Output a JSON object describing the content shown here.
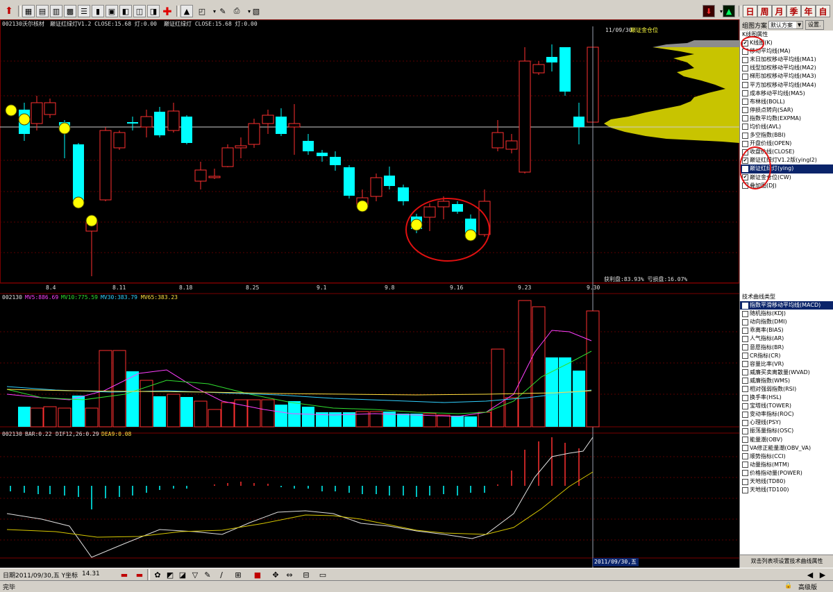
{
  "toolbar": {
    "periods": [
      "日",
      "周",
      "月",
      "季",
      "年",
      "自"
    ]
  },
  "main_chart": {
    "title_left": "002130沃尔核材",
    "indicator_text": "巅证红绿灯V1.2 CLOSE:15.68 灯:0.00",
    "indicator_text2": "巅证红绿灯 CLOSE:15.68 灯:0.00",
    "cursor_date_label": "11/09/30",
    "position_label": "巅证金仓位",
    "profit_text": "获利盘:83.93% 亏损盘:16.07%",
    "date_ticks": [
      "8.4",
      "8.11",
      "8.18",
      "8.25",
      "9.1",
      "9.8",
      "9.16",
      "9.23",
      "9.30"
    ]
  },
  "volume_panel": {
    "code": "002130",
    "mv5": "MV5:886.69",
    "mv10": "MV10:775.59",
    "mv30": "MV30:383.79",
    "mv65": "MV65:383.23"
  },
  "macd_panel": {
    "code": "002130",
    "bar": "BAR:0.22",
    "dif": "DIF12,26:0.29",
    "dea": "DEA9:0.08"
  },
  "right_panel": {
    "scheme_label": "组图方案",
    "scheme_value": "默认方案",
    "settings_button": "设置.",
    "kline_group": "K线图属性",
    "kline_items": [
      {
        "label": "K线图(K)",
        "checked": true
      },
      {
        "label": "移动平均线(MA)",
        "checked": false
      },
      {
        "label": "末日加权移动平均线(MA1)",
        "checked": false
      },
      {
        "label": "线型加权移动平均线(MA2)",
        "checked": false
      },
      {
        "label": "梯形加权移动平均线(MA3)",
        "checked": false
      },
      {
        "label": "平方加权移动平均线(MA4)",
        "checked": false
      },
      {
        "label": "成本移动平均线(MA5)",
        "checked": false
      },
      {
        "label": "布林线(BOLL)",
        "checked": false
      },
      {
        "label": "停损点转向(SAR)",
        "checked": false
      },
      {
        "label": "指数平均数(EXPMA)",
        "checked": false
      },
      {
        "label": "均价线(AVL)",
        "checked": false
      },
      {
        "label": "多空指数(BBI)",
        "checked": false
      },
      {
        "label": "开盘价线(OPEN)",
        "checked": false
      },
      {
        "label": "收盘价线(CLOSE)",
        "checked": false
      },
      {
        "label": "巅证红绿灯V1.2版(yingl2)",
        "checked": true
      },
      {
        "label": "巅证红绿灯(ying)",
        "checked": false,
        "selected": true
      },
      {
        "label": "巅证金仓位(CW)",
        "checked": true
      },
      {
        "label": "叠加图(DJ)",
        "checked": false
      }
    ],
    "tech_group": "技术曲线类型",
    "tech_items": [
      {
        "label": "指数平滑移动平均线(MACD)",
        "selected": true
      },
      {
        "label": "随机指标(KDJ)"
      },
      {
        "label": "动向指数(DMI)"
      },
      {
        "label": "乖离率(BIAS)"
      },
      {
        "label": "人气指标(AR)"
      },
      {
        "label": "意愿指标(BR)"
      },
      {
        "label": "CR指标(CR)"
      },
      {
        "label": "容量比率(VR)"
      },
      {
        "label": "威廉买卖离散量(WVAD)"
      },
      {
        "label": "威廉指数(WMS)"
      },
      {
        "label": "相对强弱指数(RSI)"
      },
      {
        "label": "换手率(HSL)"
      },
      {
        "label": "宝塔线(TOWER)"
      },
      {
        "label": "变动率指标(ROC)"
      },
      {
        "label": "心理线(PSY)"
      },
      {
        "label": "振荡量指标(OSC)"
      },
      {
        "label": "能量潮(OBV)"
      },
      {
        "label": "VA修正能量潮(OBV_VA)"
      },
      {
        "label": "顺势指标(CCI)"
      },
      {
        "label": "动量指标(MTM)"
      },
      {
        "label": "价格指动量(POWER)"
      },
      {
        "label": "天地线(TD80)"
      },
      {
        "label": "天地线(TD100)"
      }
    ],
    "footer": "双击列表项设置技术曲线属性"
  },
  "status": {
    "date_text": "日期2011/09/30,五 Y坐标",
    "y_value": "14.31",
    "cursor_date_box": "2011/09/30,五",
    "done": "完毕",
    "level": "高级版"
  }
}
